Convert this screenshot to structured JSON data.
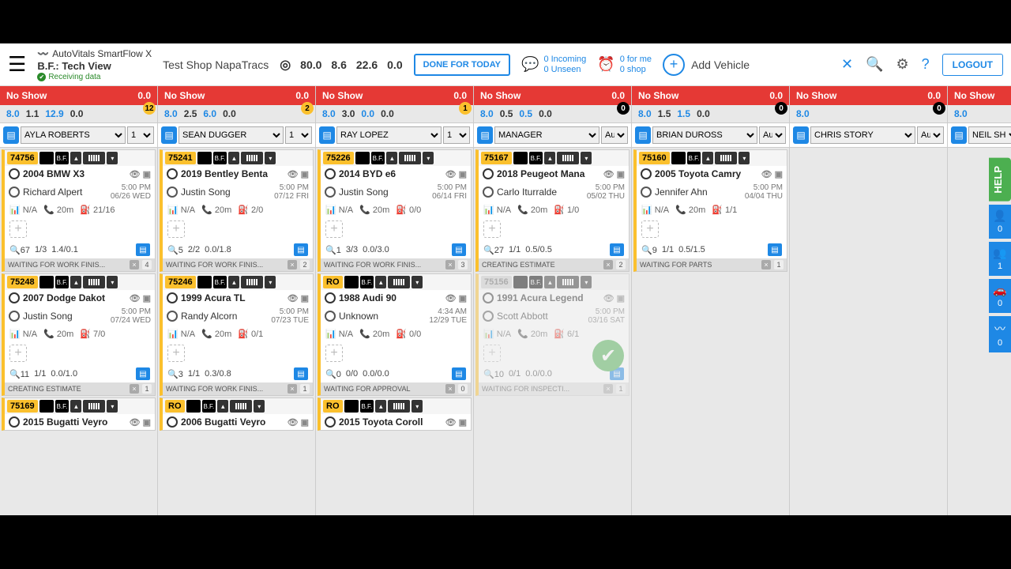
{
  "header": {
    "brand": "AutoVitals SmartFlow X",
    "view": "B.F.: Tech View",
    "shop": "Test Shop NapaTracs",
    "receiving": "Receiving data",
    "metrics": [
      "80.0",
      "8.6",
      "22.6",
      "0.0"
    ],
    "done": "DONE FOR TODAY",
    "notif1": {
      "a": "0",
      "al": "Incoming",
      "b": "0",
      "bl": "Unseen"
    },
    "notif2": {
      "a": "0",
      "al": "for me",
      "b": "0",
      "bl": "shop"
    },
    "add": "Add Vehicle",
    "logout": "LOGOUT"
  },
  "columns": [
    {
      "noshow": "No Show",
      "nsval": "0.0",
      "hours": [
        "8.0",
        "1.1",
        "12.9",
        "0.0"
      ],
      "badge": "12",
      "badgeStyle": "y",
      "tech": "AYLA ROBERTS",
      "techOpt": "1",
      "cards": [
        {
          "ro": "74756",
          "veh": "2004 BMW X3",
          "cust": "Richard Alpert",
          "t1": "5:00 PM",
          "t2": "06/26 WED",
          "na": "N/A",
          "m": "20m",
          "r": "21/16",
          "s1": "67",
          "s2": "1/3",
          "s3": "1.4/0.1",
          "status": "WAITING FOR WORK FINIS...",
          "sn": "4"
        },
        {
          "ro": "75248",
          "veh": "2007 Dodge Dakot",
          "cust": "Justin Song",
          "t1": "5:00 PM",
          "t2": "07/24 WED",
          "na": "N/A",
          "m": "20m",
          "r": "7/0",
          "s1": "11",
          "s2": "1/1",
          "s3": "0.0/1.0",
          "status": "CREATING ESTIMATE",
          "sn": "1"
        },
        {
          "ro": "75169",
          "veh": "2015 Bugatti Veyro",
          "cust": "",
          "toponly": true
        }
      ]
    },
    {
      "noshow": "No Show",
      "nsval": "0.0",
      "hours": [
        "8.0",
        "2.5",
        "6.0",
        "0.0"
      ],
      "badge": "2",
      "badgeStyle": "y",
      "tech": "SEAN DUGGER",
      "techOpt": "1",
      "cards": [
        {
          "ro": "75241",
          "veh": "2019 Bentley Benta",
          "cust": "Justin Song",
          "t1": "5:00 PM",
          "t2": "07/12 FRI",
          "na": "N/A",
          "m": "20m",
          "r": "2/0",
          "s1": "5",
          "s2": "2/2",
          "s3": "0.0/1.8",
          "status": "WAITING FOR WORK FINIS...",
          "sn": "2"
        },
        {
          "ro": "75246",
          "veh": "1999 Acura TL",
          "cust": "Randy Alcorn",
          "t1": "5:00 PM",
          "t2": "07/23 TUE",
          "na": "N/A",
          "m": "20m",
          "r": "0/1",
          "s1": "3",
          "s2": "1/1",
          "s3": "0.3/0.8",
          "status": "WAITING FOR WORK FINIS...",
          "sn": "1"
        },
        {
          "ro": "RO",
          "veh": "2006 Bugatti Veyro",
          "cust": "",
          "toponly": true
        }
      ]
    },
    {
      "noshow": "No Show",
      "nsval": "0.0",
      "hours": [
        "8.0",
        "3.0",
        "0.0",
        "0.0"
      ],
      "badge": "1",
      "badgeStyle": "y",
      "tech": "RAY LOPEZ",
      "techOpt": "1",
      "cards": [
        {
          "ro": "75226",
          "veh": "2014 BYD e6",
          "cust": "Justin Song",
          "t1": "5:00 PM",
          "t2": "06/14 FRI",
          "na": "N/A",
          "m": "20m",
          "r": "0/0",
          "s1": "1",
          "s2": "3/3",
          "s3": "0.0/3.0",
          "status": "WAITING FOR WORK FINIS...",
          "sn": "3"
        },
        {
          "ro": "RO",
          "veh": "1988 Audi 90",
          "cust": "Unknown",
          "t1": "4:34 AM",
          "t2": "12/29 TUE",
          "na": "N/A",
          "m": "20m",
          "r": "0/0",
          "s1": "0",
          "s2": "0/0",
          "s3": "0.0/0.0",
          "status": "WAITING FOR APPROVAL",
          "sn": "0"
        },
        {
          "ro": "RO",
          "veh": "2015 Toyota Coroll",
          "cust": "",
          "toponly": true
        }
      ]
    },
    {
      "noshow": "No Show",
      "nsval": "0.0",
      "hours": [
        "8.0",
        "0.5",
        "0.5",
        "0.0"
      ],
      "badge": "0",
      "badgeStyle": "k",
      "tech": "MANAGER",
      "techOpt": "Auto",
      "cards": [
        {
          "ro": "75167",
          "veh": "2018 Peugeot Mana",
          "cust": "Carlo Iturralde",
          "t1": "5:00 PM",
          "t2": "05/02 THU",
          "na": "N/A",
          "m": "20m",
          "r": "1/0",
          "s1": "27",
          "s2": "1/1",
          "s3": "0.5/0.5",
          "status": "CREATING ESTIMATE",
          "sn": "2"
        },
        {
          "ro": "75156",
          "roGrey": true,
          "veh": "1991 Acura Legend",
          "cust": "Scott Abbott",
          "t1": "5:00 PM",
          "t2": "03/16 SAT",
          "na": "N/A",
          "m": "20m",
          "r": "6/1",
          "s1": "10",
          "s2": "0/1",
          "s3": "0.0/0.0",
          "status": "WAITING FOR INSPECTI...",
          "sn": "1",
          "faded": true,
          "check": true
        }
      ]
    },
    {
      "noshow": "No Show",
      "nsval": "0.0",
      "hours": [
        "8.0",
        "1.5",
        "1.5",
        "0.0"
      ],
      "badge": "0",
      "badgeStyle": "k",
      "tech": "BRIAN DUROSS",
      "techOpt": "Auto",
      "cards": [
        {
          "ro": "75160",
          "veh": "2005 Toyota Camry",
          "cust": "Jennifer Ahn",
          "t1": "5:00 PM",
          "t2": "04/04 THU",
          "na": "N/A",
          "m": "20m",
          "r": "1/1",
          "s1": "9",
          "s2": "1/1",
          "s3": "0.5/1.5",
          "status": "WAITING FOR PARTS",
          "sn": "1"
        }
      ]
    },
    {
      "noshow": "No Show",
      "nsval": "0.0",
      "hours": [
        "8.0",
        "",
        "",
        ""
      ],
      "badge": "0",
      "badgeStyle": "k",
      "tech": "CHRIS STORY",
      "techOpt": "Auto",
      "cards": []
    },
    {
      "noshow": "No Show",
      "nsval": "",
      "hours": [
        "8.0",
        "",
        "",
        ""
      ],
      "badge": "",
      "badgeStyle": "",
      "tech": "NEIL SH",
      "techOpt": "",
      "narrow": true,
      "cards": []
    }
  ],
  "rail": {
    "help": "HELP",
    "items": [
      "0",
      "1",
      "0",
      "0"
    ]
  }
}
